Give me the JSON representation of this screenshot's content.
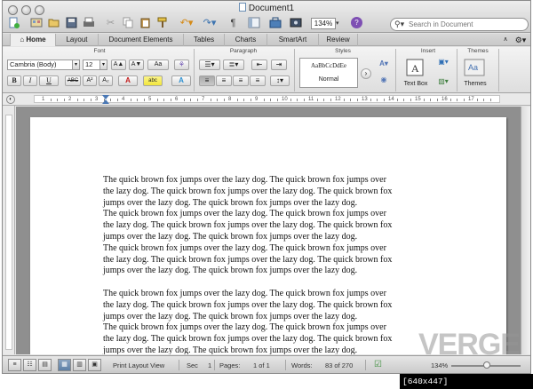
{
  "window": {
    "title": "Document1"
  },
  "toolbar": {
    "zoom": "134%",
    "search_placeholder": "Search in Document",
    "pilcrow": "¶",
    "help": "?"
  },
  "ribbon_tabs": [
    {
      "label": "Home",
      "active": true
    },
    {
      "label": "Layout"
    },
    {
      "label": "Document Elements"
    },
    {
      "label": "Tables"
    },
    {
      "label": "Charts"
    },
    {
      "label": "SmartArt"
    },
    {
      "label": "Review"
    }
  ],
  "ribbon": {
    "groups": {
      "font": "Font",
      "paragraph": "Paragraph",
      "styles": "Styles",
      "insert": "Insert",
      "themes": "Themes"
    },
    "font_name": "Cambria (Body)",
    "font_size": "12",
    "style_sample": "AaBbCcDdEe",
    "style_name": "Normal",
    "text_box": "Text Box",
    "themes_btn": "Themes",
    "font_buttons": {
      "bold": "B",
      "italic": "I",
      "underline": "U",
      "strike": "ABC",
      "superscript": "A²",
      "subscript": "A₂",
      "font_color": "A",
      "grow": "A▲",
      "shrink": "A▼",
      "case": "Aa"
    }
  },
  "ruler_numbers": [
    "1",
    "2",
    "3",
    "4",
    "5",
    "6",
    "7",
    "8",
    "9",
    "10",
    "11",
    "12",
    "13",
    "14",
    "15",
    "16",
    "17"
  ],
  "document": {
    "paragraphs": [
      [
        "The quick brown fox jumps over the lazy dog.  The quick brown fox jumps over",
        "the lazy dog.  The quick brown fox jumps over the lazy dog.  The quick brown fox",
        "jumps over the lazy dog.  The quick brown fox jumps over the lazy dog.",
        "The quick brown fox jumps over the lazy dog.  The quick brown fox jumps over",
        "the lazy dog.  The quick brown fox jumps over the lazy dog.  The quick brown fox",
        "jumps over the lazy dog.  The quick brown fox jumps over the lazy dog.",
        "The quick brown fox jumps over the lazy dog.  The quick brown fox jumps over",
        "the lazy dog.  The quick brown fox jumps over the lazy dog.  The quick brown fox",
        "jumps over the lazy dog.  The quick brown fox jumps over the lazy dog."
      ],
      [
        "The quick brown fox jumps over the lazy dog.  The quick brown fox jumps over",
        "the lazy dog.  The quick brown fox jumps over the lazy dog.  The quick brown fox",
        "jumps over the lazy dog.  The quick brown fox jumps over the lazy dog.",
        "The quick brown fox jumps over the lazy dog.  The quick brown fox jumps over",
        "the lazy dog.  The quick brown fox jumps over the lazy dog.  The quick brown fox",
        "jumps over the lazy dog.  The quick brown fox jumps over the lazy dog."
      ]
    ]
  },
  "status": {
    "view": "Print Layout View",
    "sec_label": "Sec",
    "sec_value": "1",
    "pages_label": "Pages:",
    "pages_value": "1 of 1",
    "words_label": "Words:",
    "words_value": "83 of 270",
    "zoom": "134%"
  },
  "watermark": "VERGE",
  "credit": "[640x447] https://upic.me/"
}
